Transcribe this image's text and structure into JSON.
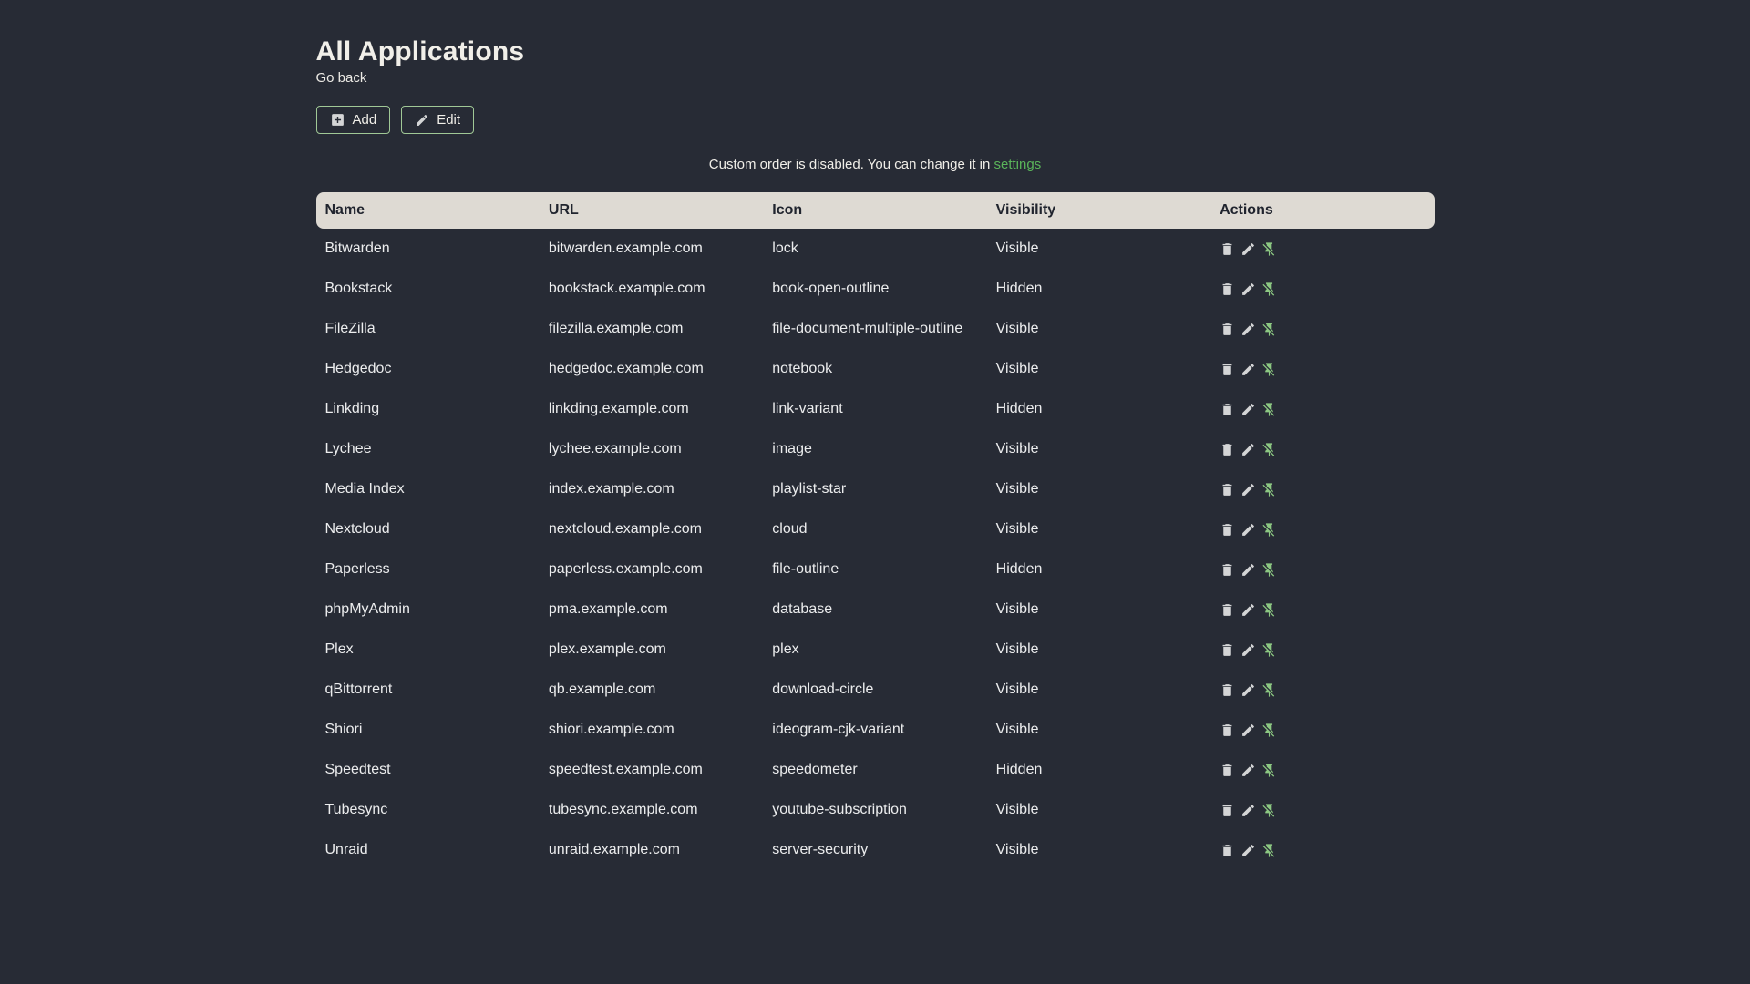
{
  "page": {
    "title": "All Applications",
    "back_label": "Go back",
    "notice_text": "Custom order is disabled. You can change it in",
    "notice_link": "settings"
  },
  "toolbar": {
    "add_label": "Add",
    "edit_label": "Edit"
  },
  "table": {
    "columns": [
      "Name",
      "URL",
      "Icon",
      "Visibility",
      "Actions"
    ],
    "action_icons": [
      "delete-icon",
      "edit-icon",
      "pin-off-icon"
    ],
    "rows": [
      {
        "name": "Bitwarden",
        "url": "bitwarden.example.com",
        "icon": "lock",
        "visibility": "Visible"
      },
      {
        "name": "Bookstack",
        "url": "bookstack.example.com",
        "icon": "book-open-outline",
        "visibility": "Hidden"
      },
      {
        "name": "FileZilla",
        "url": "filezilla.example.com",
        "icon": "file-document-multiple-outline",
        "visibility": "Visible"
      },
      {
        "name": "Hedgedoc",
        "url": "hedgedoc.example.com",
        "icon": "notebook",
        "visibility": "Visible"
      },
      {
        "name": "Linkding",
        "url": "linkding.example.com",
        "icon": "link-variant",
        "visibility": "Hidden"
      },
      {
        "name": "Lychee",
        "url": "lychee.example.com",
        "icon": "image",
        "visibility": "Visible"
      },
      {
        "name": "Media Index",
        "url": "index.example.com",
        "icon": "playlist-star",
        "visibility": "Visible"
      },
      {
        "name": "Nextcloud",
        "url": "nextcloud.example.com",
        "icon": "cloud",
        "visibility": "Visible"
      },
      {
        "name": "Paperless",
        "url": "paperless.example.com",
        "icon": "file-outline",
        "visibility": "Hidden"
      },
      {
        "name": "phpMyAdmin",
        "url": "pma.example.com",
        "icon": "database",
        "visibility": "Visible"
      },
      {
        "name": "Plex",
        "url": "plex.example.com",
        "icon": "plex",
        "visibility": "Visible"
      },
      {
        "name": "qBittorrent",
        "url": "qb.example.com",
        "icon": "download-circle",
        "visibility": "Visible"
      },
      {
        "name": "Shiori",
        "url": "shiori.example.com",
        "icon": "ideogram-cjk-variant",
        "visibility": "Visible"
      },
      {
        "name": "Speedtest",
        "url": "speedtest.example.com",
        "icon": "speedometer",
        "visibility": "Hidden"
      },
      {
        "name": "Tubesync",
        "url": "tubesync.example.com",
        "icon": "youtube-subscription",
        "visibility": "Visible"
      },
      {
        "name": "Unraid",
        "url": "unraid.example.com",
        "icon": "server-security",
        "visibility": "Visible"
      }
    ]
  },
  "colors": {
    "background": "#272b35",
    "accent_border_green": "#a0c896",
    "link_green": "#5ab45a",
    "pin_icon_green": "#8cc882",
    "table_header_bg": "#dedad3",
    "table_header_text": "#20242e",
    "row_text": "#ecedee"
  }
}
